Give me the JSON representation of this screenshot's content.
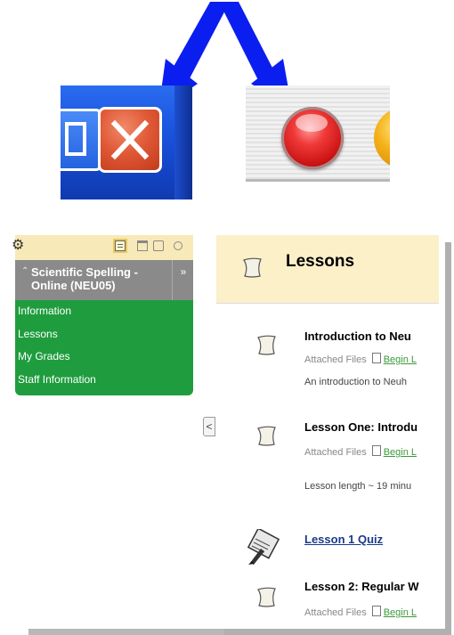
{
  "colors": {
    "arrow": "#0a1ef0",
    "xp_blue": "#1c56e0",
    "xp_close": "#e15a38",
    "mac_red": "#e82020",
    "menu_green": "#1f9d3e",
    "menu_header_gray": "#8a8a8a",
    "header_yellow": "#fbf0c8",
    "link_green": "#3a9a3a",
    "quiz_link": "#1a3a8a"
  },
  "icons": [
    "double-arrow-icon",
    "xp-close-icon",
    "mac-close-icon",
    "mac-minimize-icon",
    "gear-icon",
    "list-view-icon",
    "folder-view-icon",
    "window-view-icon",
    "pin-icon",
    "chevron-up-icon",
    "double-chevron-right-icon",
    "chevron-left-icon",
    "document-icon",
    "quiz-icon",
    "file-icon"
  ],
  "course_menu": {
    "title": "Scientific Spelling - Online (NEU05)",
    "expand_glyph": "»",
    "links": [
      "Information",
      "Lessons",
      "My Grades",
      "Staff Information"
    ]
  },
  "collapse_glyph": "<",
  "lessons": {
    "header": "Lessons",
    "items": [
      {
        "title": "Introduction to Neu",
        "attached_label": "Attached Files",
        "file_link": "Begin L",
        "description": "An introduction to Neuh"
      },
      {
        "title": "Lesson One: Introdu",
        "attached_label": "Attached Files",
        "file_link": "Begin L",
        "description": "Lesson length ~ 19 minu"
      },
      {
        "title": "Lesson 1 Quiz"
      },
      {
        "title": "Lesson 2: Regular W",
        "attached_label": "Attached Files",
        "file_link": "Begin L"
      }
    ]
  }
}
